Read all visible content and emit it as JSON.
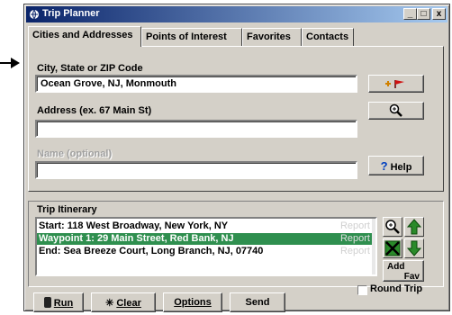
{
  "window": {
    "title": "Trip Planner",
    "minimize": "_",
    "maximize": "□",
    "close": "x"
  },
  "tabs": [
    {
      "label": "Cities and Addresses"
    },
    {
      "label": "Points of Interest"
    },
    {
      "label": "Favorites"
    },
    {
      "label": "Contacts"
    }
  ],
  "form": {
    "city_label": "City, State or ZIP Code",
    "city_value": "Ocean Grove, NJ, Monmouth",
    "address_label": "Address (ex. 67 Main St)",
    "address_value": "",
    "name_label": "Name (optional)",
    "name_value": "",
    "help_label": "Help"
  },
  "itinerary": {
    "title": "Trip Itinerary",
    "rows": [
      {
        "text": "Start: 118 West Broadway, New York, NY",
        "action": "Report"
      },
      {
        "text": "Waypoint 1: 29 Main Street, Red Bank, NJ",
        "action": "Report"
      },
      {
        "text": "End: Sea Breeze Court, Long Branch, NJ, 07740",
        "action": "Report"
      }
    ],
    "add_fav_top": "Add",
    "add_fav_bottom": "Fav",
    "round_trip_label": "Round Trip"
  },
  "bottom": {
    "run_label": "Run",
    "clear_label": "Clear",
    "options_label": "Options",
    "send_label": "Send"
  },
  "colors": {
    "selected_row": "#2f8f4f",
    "titlebar": "#0a246a"
  }
}
